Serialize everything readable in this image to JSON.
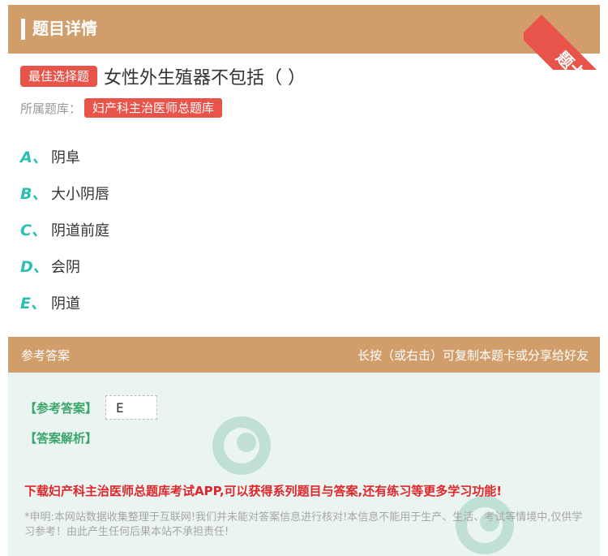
{
  "header": {
    "title": "题目详情",
    "corner_label": "题卡"
  },
  "question": {
    "type_badge": "最佳选择题",
    "text": "女性外生殖器不包括（ ）",
    "category_label": "所属题库：",
    "category_value": "妇产科主治医师总题库"
  },
  "options": [
    {
      "letter": "A、",
      "text": "阴阜"
    },
    {
      "letter": "B、",
      "text": "大小阴唇"
    },
    {
      "letter": "C、",
      "text": "阴道前庭"
    },
    {
      "letter": "D、",
      "text": "会阴"
    },
    {
      "letter": "E、",
      "text": "阴道"
    }
  ],
  "answer_section": {
    "title": "参考答案",
    "hint": "长按（或右击）可复制本题卡或分享给好友",
    "answer_label": "【参考答案】",
    "answer_value": "E",
    "analysis_label": "【答案解析】",
    "promo": "下载妇产科主治医师总题库考试APP,可以获得系列题目与答案,还有练习等更多学习功能!",
    "disclaimer": "*申明:本网站数据收集整理于互联网!我们并未能对答案信息进行核对!本信息不能用于生产、生活、考试等情境中,仅供学习参考！由此产生任何后果本站不承担责任!"
  },
  "colors": {
    "accent_tan": "#d19e6b",
    "badge_red": "#e8534a",
    "option_teal": "#2bbfb3",
    "answer_green": "#3ca56b",
    "promo_red": "#e0262b"
  },
  "icons": [
    "corner-ribbon",
    "watermark-logo"
  ]
}
